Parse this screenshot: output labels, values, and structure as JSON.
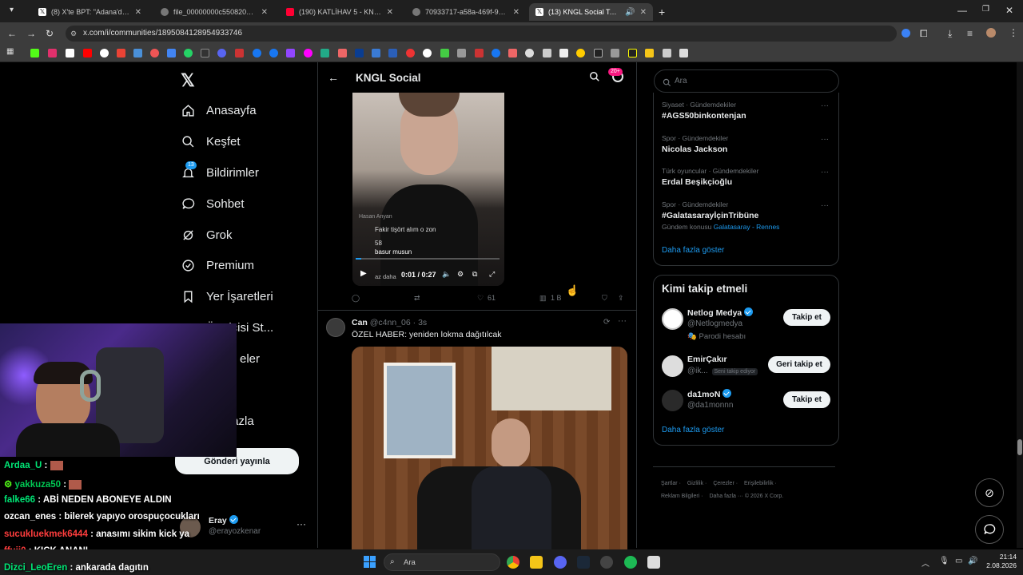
{
  "browser": {
    "tabs": [
      {
        "label": "(8) X'te BPT: \"Adana'da küçük y",
        "icon": "x-icon"
      },
      {
        "label": "file_00000000c550820ab68ca3",
        "icon": "globe-icon"
      },
      {
        "label": "(190) KATLİHAV 5 - KNGL X ERA",
        "icon": "youtube-icon"
      },
      {
        "label": "70933717-a58a-469f-9632-dca",
        "icon": "globe-icon"
      },
      {
        "label": "(13) KNGL Social Topluluk /",
        "icon": "x-icon"
      }
    ],
    "url": "x.com/i/communities/1895084128954933746"
  },
  "nav": {
    "items": [
      {
        "label": "Anasayfa",
        "icon": "home-icon"
      },
      {
        "label": "Keşfet",
        "icon": "search-icon"
      },
      {
        "label": "Bildirimler",
        "icon": "bell-icon",
        "badge": "13"
      },
      {
        "label": "Sohbet",
        "icon": "chat-icon"
      },
      {
        "label": "Grok",
        "icon": "grok-icon"
      },
      {
        "label": "Premium",
        "icon": "premium-icon"
      },
      {
        "label": "Yer İşaretleri",
        "icon": "bookmark-icon"
      },
      {
        "label": "Üreticisi St...",
        "icon": "creator-icon"
      },
      {
        "label": "eler",
        "icon": "list-icon"
      },
      {
        "label": "fazla",
        "icon": "more-icon"
      }
    ],
    "post_button": "Gönderi yayınla",
    "account": {
      "name": "Eray",
      "handle": "@erayozkenar"
    }
  },
  "community": {
    "title": "KNGL Social",
    "badge": "20+"
  },
  "post1": {
    "comment_user": "Hasan Anyan",
    "comment_text": "Fakir tişört alım o zon",
    "reply_count": "58",
    "reply_text": "basur musun",
    "reply2_text": "az daha",
    "time": "0:01 / 0:27",
    "likes": "61",
    "views": "1 B"
  },
  "post2": {
    "name": "Can",
    "handle": "@c4nn_06",
    "time": "3s",
    "text": "ÖZEL HABER: yeniden lokma dağıtılcak"
  },
  "search": {
    "placeholder": "Ara"
  },
  "trends": [
    {
      "category": "Siyaset · Gündemdekiler",
      "name": "#AGS50binkontenjan"
    },
    {
      "category": "Spor · Gündemdekiler",
      "name": "Nicolas Jackson"
    },
    {
      "category": "Türk oyuncular · Gündemdekiler",
      "name": "Erdal Beşikçioğlu"
    },
    {
      "category": "Spor · Gündemdekiler",
      "name": "#GalatasarayİçinTribüne",
      "topic_prefix": "Gündem konusu",
      "topic": "Galatasaray - Rennes"
    }
  ],
  "trends_more": "Daha fazla göster",
  "who_to_follow": {
    "title": "Kimi takip etmeli",
    "users": [
      {
        "name": "Netlog Medya",
        "handle": "@Netlogmedya",
        "sub": "Parodi hesabı",
        "button": "Takip et",
        "verified": true
      },
      {
        "name": "EmirÇakır",
        "handle": "@ik...",
        "sub_badge": "Seni takip ediyor",
        "button": "Geri takip et",
        "verified": false
      },
      {
        "name": "da1moN",
        "handle": "@da1monnn",
        "button": "Takip et",
        "verified": true
      }
    ],
    "more": "Daha fazla göster"
  },
  "footer": {
    "links": [
      "Şartlar",
      "Gizlilik",
      "Çerezler",
      "Erişilebilirlik",
      "Reklam Bilgileri",
      "Daha fazla ···",
      "© 2026 X Corp."
    ]
  },
  "chat": [
    {
      "user": "Ardaa_U",
      "msg": ":",
      "color": "#00e676"
    },
    {
      "user": "yakkuza50",
      "msg": ":",
      "color": "#00c853"
    },
    {
      "user": "falke66",
      "msg": ": ABİ NEDEN ABONEYE ALDIN",
      "color": "#00e676"
    },
    {
      "user": "ozcan_enes",
      "msg": ": bilerek yapıyo orospuçocukları",
      "color": "#ffffff"
    },
    {
      "user": "sucukluekmek6444",
      "msg": ": anasımı sikim kick ya",
      "color": "#ff3d3d"
    },
    {
      "user": "ffuji0",
      "msg": ": KICK ANANI",
      "color": "#ff3d3d"
    },
    {
      "user": "Dizci_LeoEren",
      "msg": ": ankarada dagıtın",
      "color": "#00e676"
    }
  ],
  "taskbar": {
    "search": "Ara",
    "time": "21:14",
    "date": "2.08.2026"
  }
}
